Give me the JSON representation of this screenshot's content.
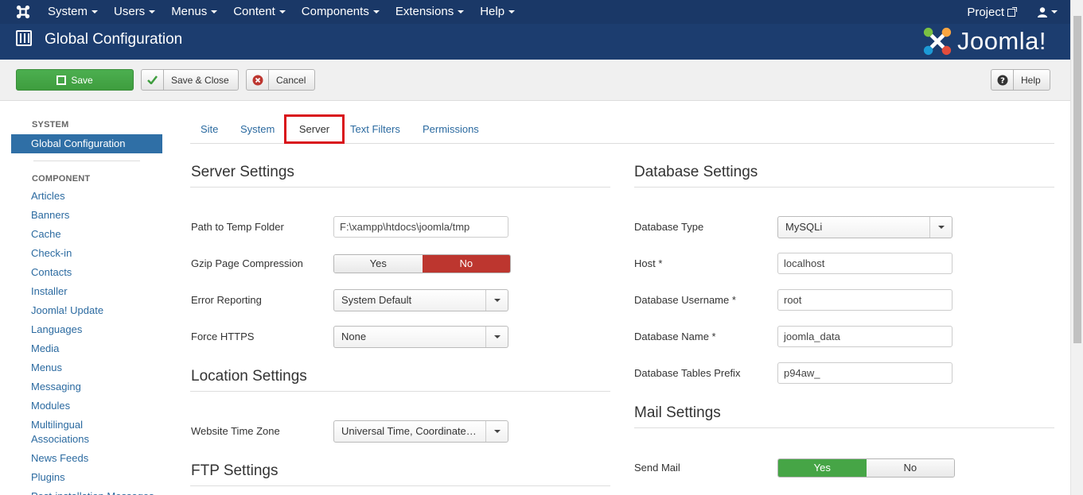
{
  "topnav": {
    "menu": [
      "System",
      "Users",
      "Menus",
      "Content",
      "Components",
      "Extensions",
      "Help"
    ],
    "project": "Project"
  },
  "header": {
    "title": "Global Configuration",
    "logo_text": "Joomla!"
  },
  "toolbar": {
    "save": "Save",
    "save_close": "Save & Close",
    "cancel": "Cancel",
    "help": "Help"
  },
  "sidebar": {
    "system_heading": "SYSTEM",
    "active_item": "Global Configuration",
    "component_heading": "COMPONENT",
    "items": [
      "Articles",
      "Banners",
      "Cache",
      "Check-in",
      "Contacts",
      "Installer",
      "Joomla! Update",
      "Languages",
      "Media",
      "Menus",
      "Messaging",
      "Modules",
      "Multilingual Associations",
      "News Feeds",
      "Plugins",
      "Post-installation Messages"
    ]
  },
  "tabs": [
    "Site",
    "System",
    "Server",
    "Text Filters",
    "Permissions"
  ],
  "active_tab": "Server",
  "server": {
    "title": "Server Settings",
    "temp_label": "Path to Temp Folder",
    "temp_value": "F:\\xampp\\htdocs\\joomla/tmp",
    "gzip_label": "Gzip Page Compression",
    "gzip_yes": "Yes",
    "gzip_no": "No",
    "error_label": "Error Reporting",
    "error_value": "System Default",
    "https_label": "Force HTTPS",
    "https_value": "None"
  },
  "location": {
    "title": "Location Settings",
    "tz_label": "Website Time Zone",
    "tz_value": "Universal Time, Coordinated (UTC)"
  },
  "ftp": {
    "title": "FTP Settings"
  },
  "database": {
    "title": "Database Settings",
    "type_label": "Database Type",
    "type_value": "MySQLi",
    "host_label": "Host *",
    "host_value": "localhost",
    "user_label": "Database Username *",
    "user_value": "root",
    "name_label": "Database Name *",
    "name_value": "joomla_data",
    "prefix_label": "Database Tables Prefix",
    "prefix_value": "p94aw_"
  },
  "mail": {
    "title": "Mail Settings",
    "send_label": "Send Mail",
    "send_yes": "Yes",
    "send_no": "No"
  },
  "colors": {
    "nav": "#1a3867",
    "header": "#1c3d6f",
    "save": "#46a546",
    "no_active": "#bd362f",
    "link": "#2b6aa0",
    "highlight": "#d9131a"
  }
}
